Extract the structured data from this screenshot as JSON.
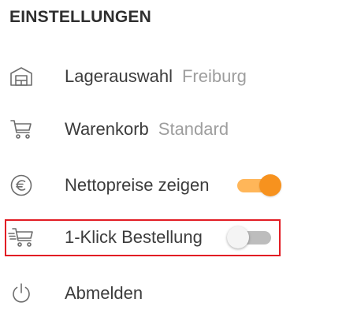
{
  "settings": {
    "title": "EINSTELLUNGEN",
    "items": [
      {
        "label": "Lagerauswahl",
        "value": "Freiburg",
        "icon": "warehouse-icon"
      },
      {
        "label": "Warenkorb",
        "value": "Standard",
        "icon": "cart-icon"
      },
      {
        "label": "Nettopreise zeigen",
        "toggle": true,
        "icon": "euro-icon"
      },
      {
        "label": "1-Klick Bestellung",
        "toggle": false,
        "icon": "fast-cart-icon",
        "highlighted": true
      },
      {
        "label": "Abmelden",
        "icon": "power-icon"
      }
    ]
  },
  "colors": {
    "accent": "#f7921e",
    "accent_track": "#ffb659",
    "highlight_border": "#e21d24",
    "muted_text": "#9e9e9e"
  }
}
